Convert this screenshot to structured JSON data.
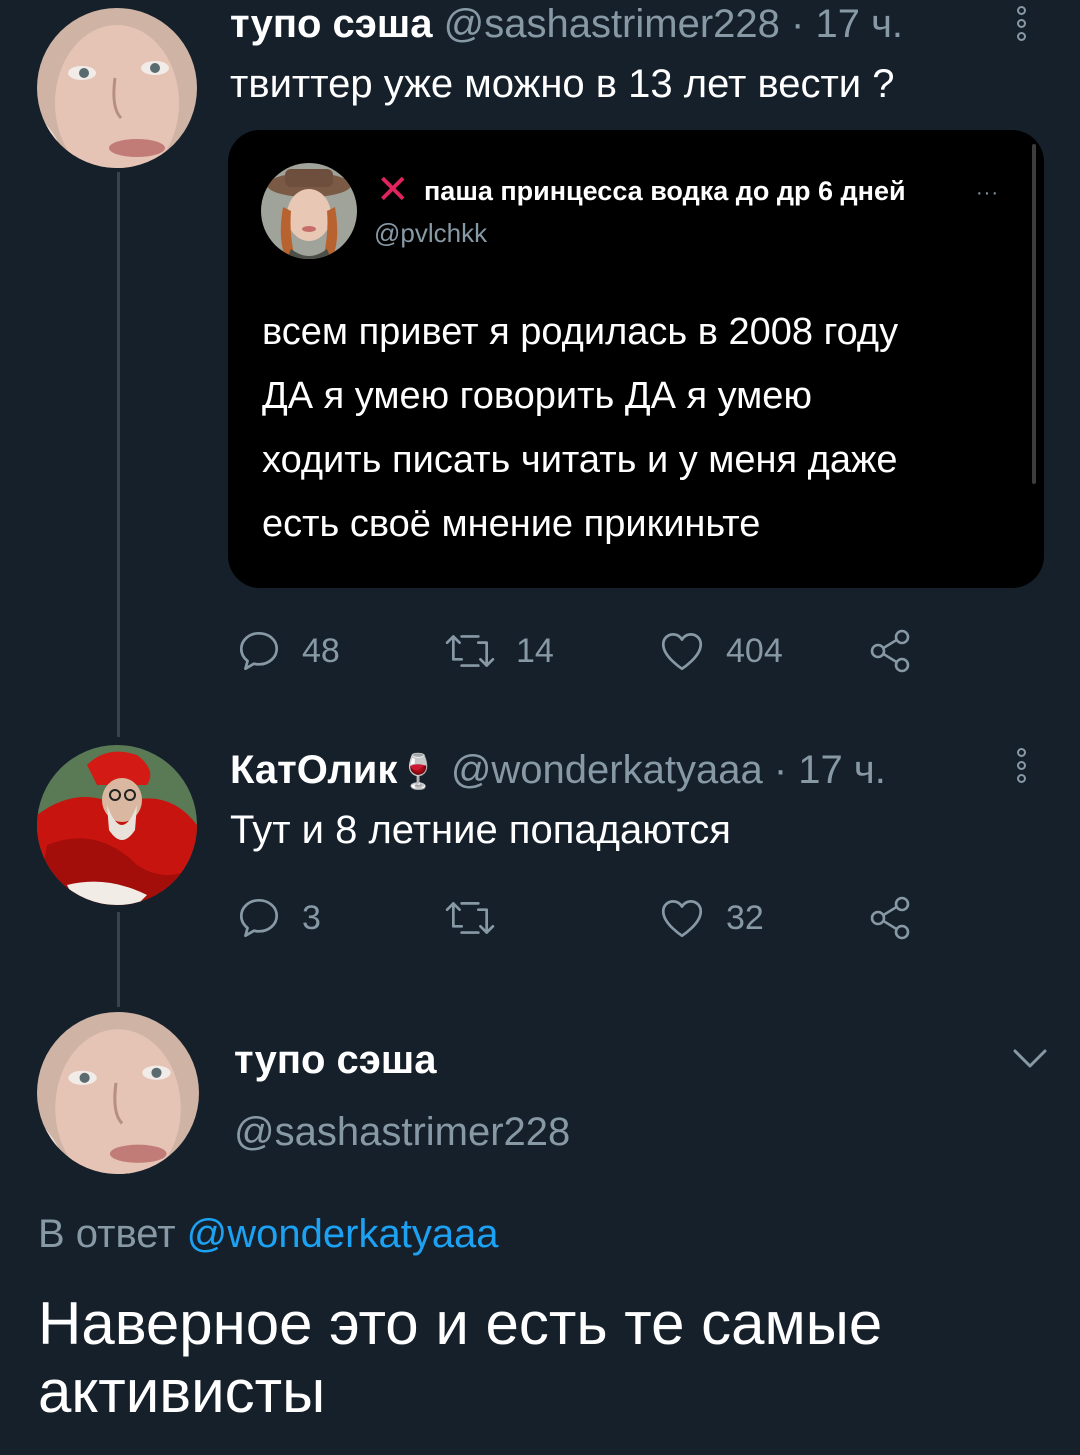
{
  "tweet1": {
    "name": "тупо сэша",
    "handle": "@sashastrimer228",
    "separator": "·",
    "time": "17 ч.",
    "text": "твиттер уже можно в 13 лет вести ?",
    "quote": {
      "x_mark": "✕",
      "name": "паша принцесса водка до др 6 дней",
      "more": "···",
      "handle": "@pvlchkk",
      "lines": [
        "всем привет я родилась в 2008 году",
        "ДА я умею говорить ДА я умею",
        "ходить писать читать и у меня даже",
        "есть своё мнение прикиньте"
      ]
    },
    "actions": {
      "replies": "48",
      "retweets": "14",
      "likes": "404"
    }
  },
  "tweet2": {
    "name": "КатОлик",
    "name_emoji": "🍷",
    "handle": "@wonderkatyaaa",
    "separator": "·",
    "time": "17 ч.",
    "text": "Тут и 8 летние попадаются",
    "actions": {
      "replies": "3",
      "retweets": "",
      "likes": "32"
    }
  },
  "tweet3": {
    "name": "тупо сэша",
    "handle": "@sashastrimer228",
    "reply_prefix": "В ответ",
    "reply_to": "@wonderkatyaaa",
    "lines": [
      "Наверное это и есть те самые",
      "активисты"
    ]
  },
  "icons": {
    "reply": "speech-bubble-icon",
    "retweet": "retweet-icon",
    "like": "heart-icon",
    "share": "share-icon",
    "more": "vertical-dots-icon",
    "expand": "chevron-down-icon"
  },
  "colors": {
    "background": "#15202b",
    "muted": "#8899a6",
    "link": "#1da1f2",
    "quote_background": "#000000"
  }
}
